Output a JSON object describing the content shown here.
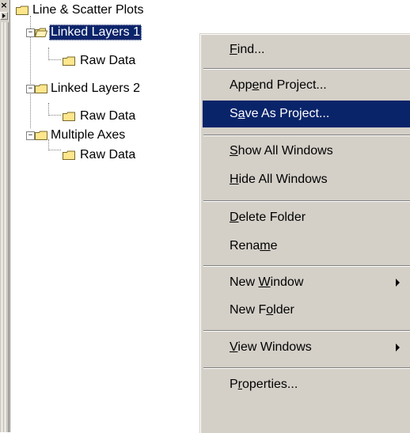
{
  "panel": {
    "close_glyph": "×",
    "icons": {
      "close": "close-icon",
      "toggle": "play-triangle-icon",
      "folder": "folder-icon"
    }
  },
  "tree": {
    "root": {
      "label": "Line & Scatter Plots"
    },
    "groups": [
      {
        "label": "Linked Layers 1",
        "selected": true,
        "expanded": true,
        "children": [
          {
            "label": "Raw Data"
          }
        ]
      },
      {
        "label": "Linked Layers 2",
        "selected": false,
        "expanded": true,
        "children": [
          {
            "label": "Raw Data"
          }
        ]
      },
      {
        "label": "Multiple Axes",
        "selected": false,
        "expanded": true,
        "children": [
          {
            "label": "Raw Data"
          }
        ]
      }
    ],
    "expander_glyph": "−"
  },
  "context_menu": {
    "highlight_color": "#0a246a",
    "items": [
      {
        "label": "Find...",
        "mnemonic": "F",
        "highlighted": false,
        "submenu": false
      },
      {
        "label": "Append Project...",
        "mnemonic": "e",
        "highlighted": false,
        "submenu": false
      },
      {
        "label": "Save As Project...",
        "mnemonic": "a",
        "highlighted": true,
        "submenu": false
      },
      {
        "label": "Show All Windows",
        "mnemonic": "S",
        "highlighted": false,
        "submenu": false
      },
      {
        "label": "Hide All Windows",
        "mnemonic": "H",
        "highlighted": false,
        "submenu": false
      },
      {
        "label": "Delete Folder",
        "mnemonic": "D",
        "highlighted": false,
        "submenu": false
      },
      {
        "label": "Rename",
        "mnemonic": "m",
        "highlighted": false,
        "submenu": false
      },
      {
        "label": "New Window",
        "mnemonic": "W",
        "highlighted": false,
        "submenu": true
      },
      {
        "label": "New Folder",
        "mnemonic": "o",
        "highlighted": false,
        "submenu": false
      },
      {
        "label": "View Windows",
        "mnemonic": "V",
        "highlighted": false,
        "submenu": true
      },
      {
        "label": "Properties...",
        "mnemonic": "r",
        "highlighted": false,
        "submenu": false
      }
    ]
  }
}
